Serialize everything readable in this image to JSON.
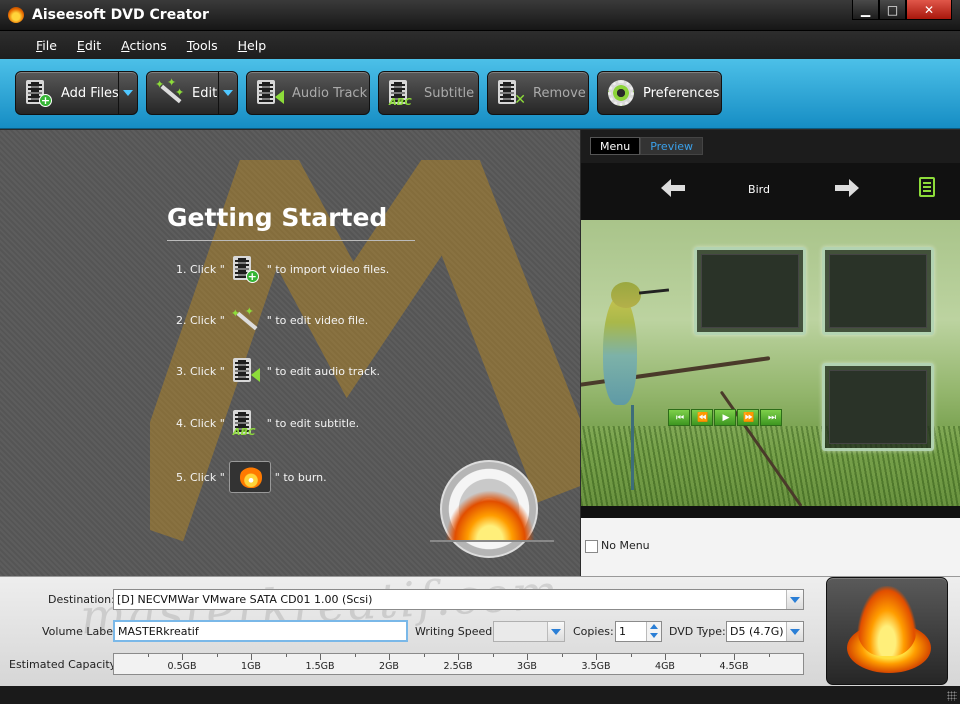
{
  "window": {
    "title": "Aiseesoft DVD Creator",
    "controls": {
      "minimize": "▁",
      "maximize": "□",
      "close": "✕"
    }
  },
  "menu": {
    "items": [
      {
        "label_ul": "F",
        "label_rest": "ile"
      },
      {
        "label_ul": "E",
        "label_rest": "dit"
      },
      {
        "label_ul": "A",
        "label_rest": "ctions"
      },
      {
        "label_ul": "T",
        "label_rest": "ools"
      },
      {
        "label_ul": "H",
        "label_rest": "elp"
      }
    ]
  },
  "toolbar": {
    "add_files": "Add Files",
    "edit": "Edit",
    "audio_track": "Audio Track",
    "subtitle": "Subtitle",
    "remove": "Remove",
    "preferences": "Preferences",
    "accent_color": "#1a9ad6"
  },
  "getting_started": {
    "title": "Getting Started",
    "steps": [
      {
        "prefix": "1. Click \"",
        "suffix": "\" to import video files."
      },
      {
        "prefix": "2. Click \"",
        "suffix": "\" to edit video file."
      },
      {
        "prefix": "3. Click \"",
        "suffix": "\" to edit audio track."
      },
      {
        "prefix": "4. Click \"",
        "suffix": "\" to edit subtitle."
      },
      {
        "prefix": "5. Click \"",
        "suffix": "\" to burn."
      }
    ]
  },
  "menu_panel": {
    "tabs": [
      {
        "label": "Menu"
      },
      {
        "label": "Preview"
      }
    ],
    "menu_name": "Bird",
    "playback_controls": [
      "⏮",
      "⏪",
      "▶",
      "⏩",
      "⏭"
    ],
    "no_menu_label": "No Menu"
  },
  "settings": {
    "destination_label": "Destination:",
    "destination_value": "[D] NECVMWar VMware SATA CD01 1.00 (Scsi)",
    "volume_label": "Volume Label:",
    "volume_value": "MASTERkreatif",
    "writing_speed_label": "Writing Speed:",
    "writing_speed_value": "",
    "copies_label": "Copies:",
    "copies_value": "1",
    "dvd_type_label": "DVD Type:",
    "dvd_type_value": "D5 (4.7G)",
    "capacity_label": "Estimated Capacity:",
    "capacity_ticks": [
      "0.5GB",
      "1GB",
      "1.5GB",
      "2GB",
      "2.5GB",
      "3GB",
      "3.5GB",
      "4GB",
      "4.5GB"
    ]
  },
  "watermark": "masterkreatif.com"
}
